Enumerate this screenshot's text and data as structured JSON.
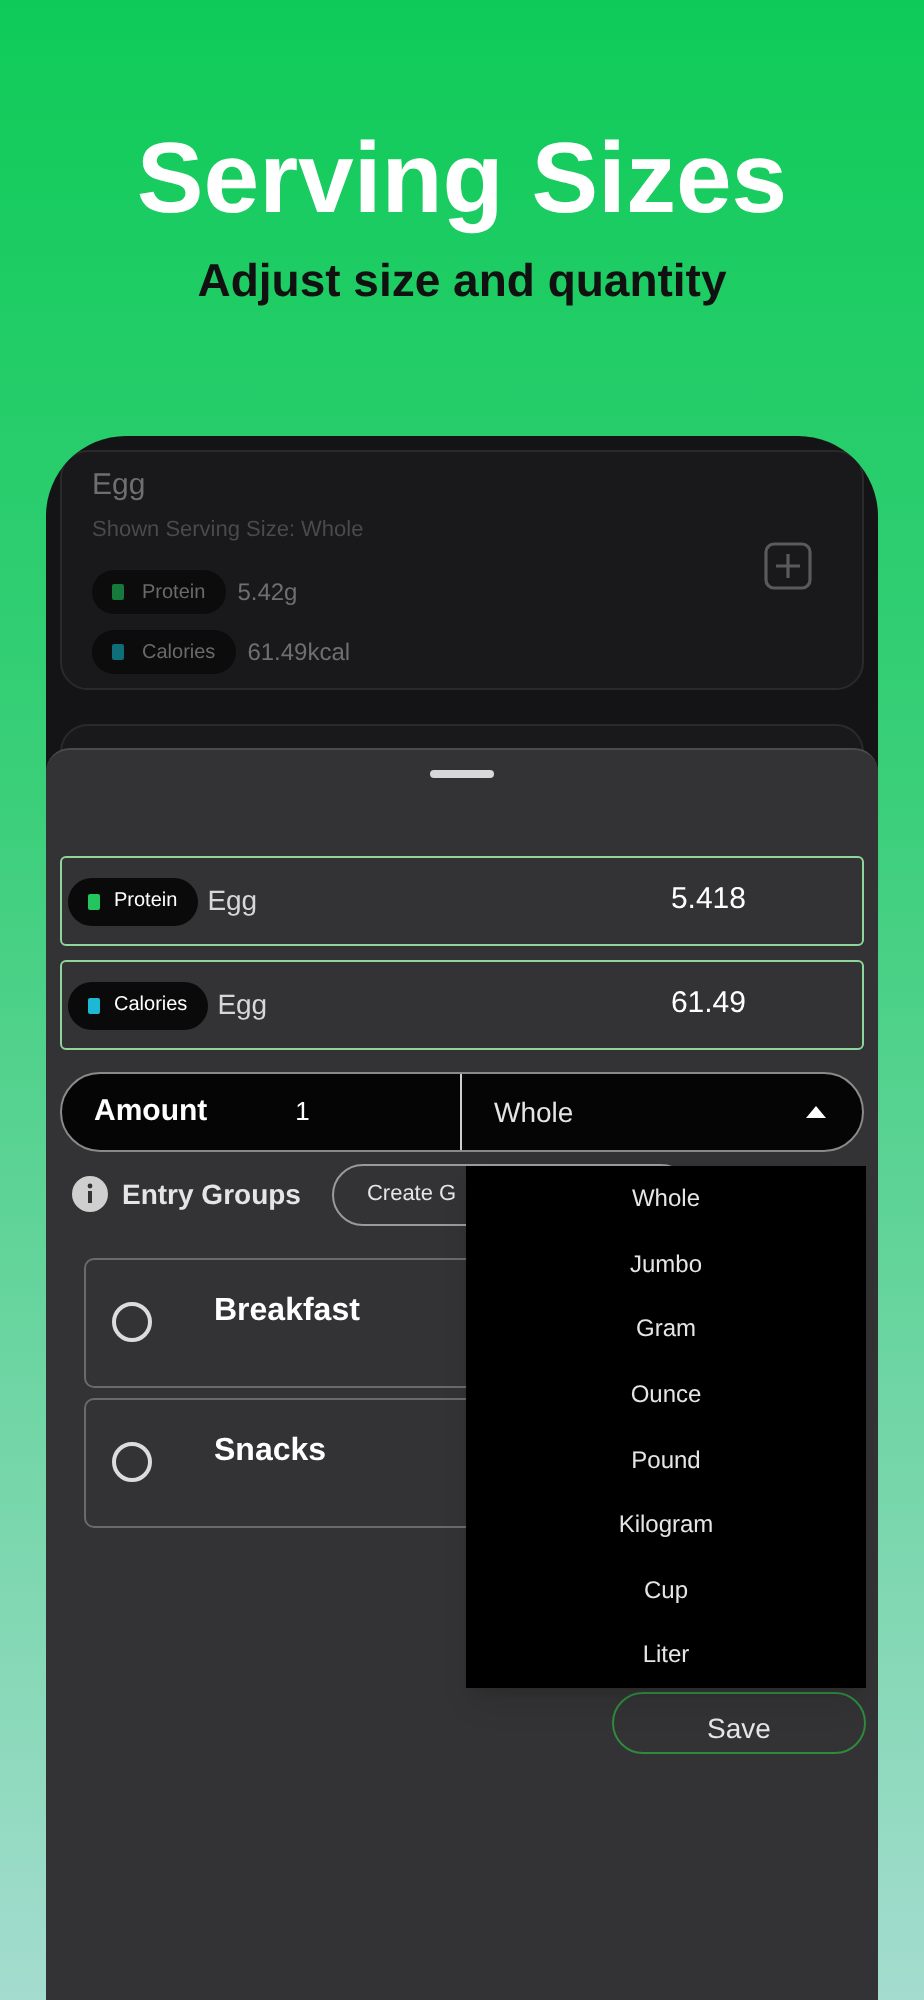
{
  "header": {
    "title": "Serving Sizes",
    "subtitle": "Adjust size and quantity"
  },
  "food_card": {
    "name": "Egg",
    "serving_note": "Shown Serving Size: Whole",
    "nutrients": [
      {
        "label": "Protein",
        "value": "5.42g",
        "color": "#157a3c"
      },
      {
        "label": "Calories",
        "value": "61.49kcal",
        "color": "#0f6f78"
      }
    ]
  },
  "sheet": {
    "entries": [
      {
        "tag": "Protein",
        "color": "#22c55e",
        "food": "Egg",
        "value": "5.418"
      },
      {
        "tag": "Calories",
        "color": "#1cb8d4",
        "food": "Egg",
        "value": "61.49"
      }
    ],
    "amount": {
      "label": "Amount",
      "value": "1",
      "unit": "Whole",
      "expanded": true
    },
    "entry_groups": {
      "label": "Entry Groups",
      "create_button": "Create G",
      "groups": [
        {
          "name": "Breakfast",
          "selected": false
        },
        {
          "name": "Snacks",
          "selected": false
        }
      ]
    },
    "unit_menu": [
      "Whole",
      "Jumbo",
      "Gram",
      "Ounce",
      "Pound",
      "Kilogram",
      "Cup",
      "Liter"
    ],
    "save_button": "Save"
  }
}
